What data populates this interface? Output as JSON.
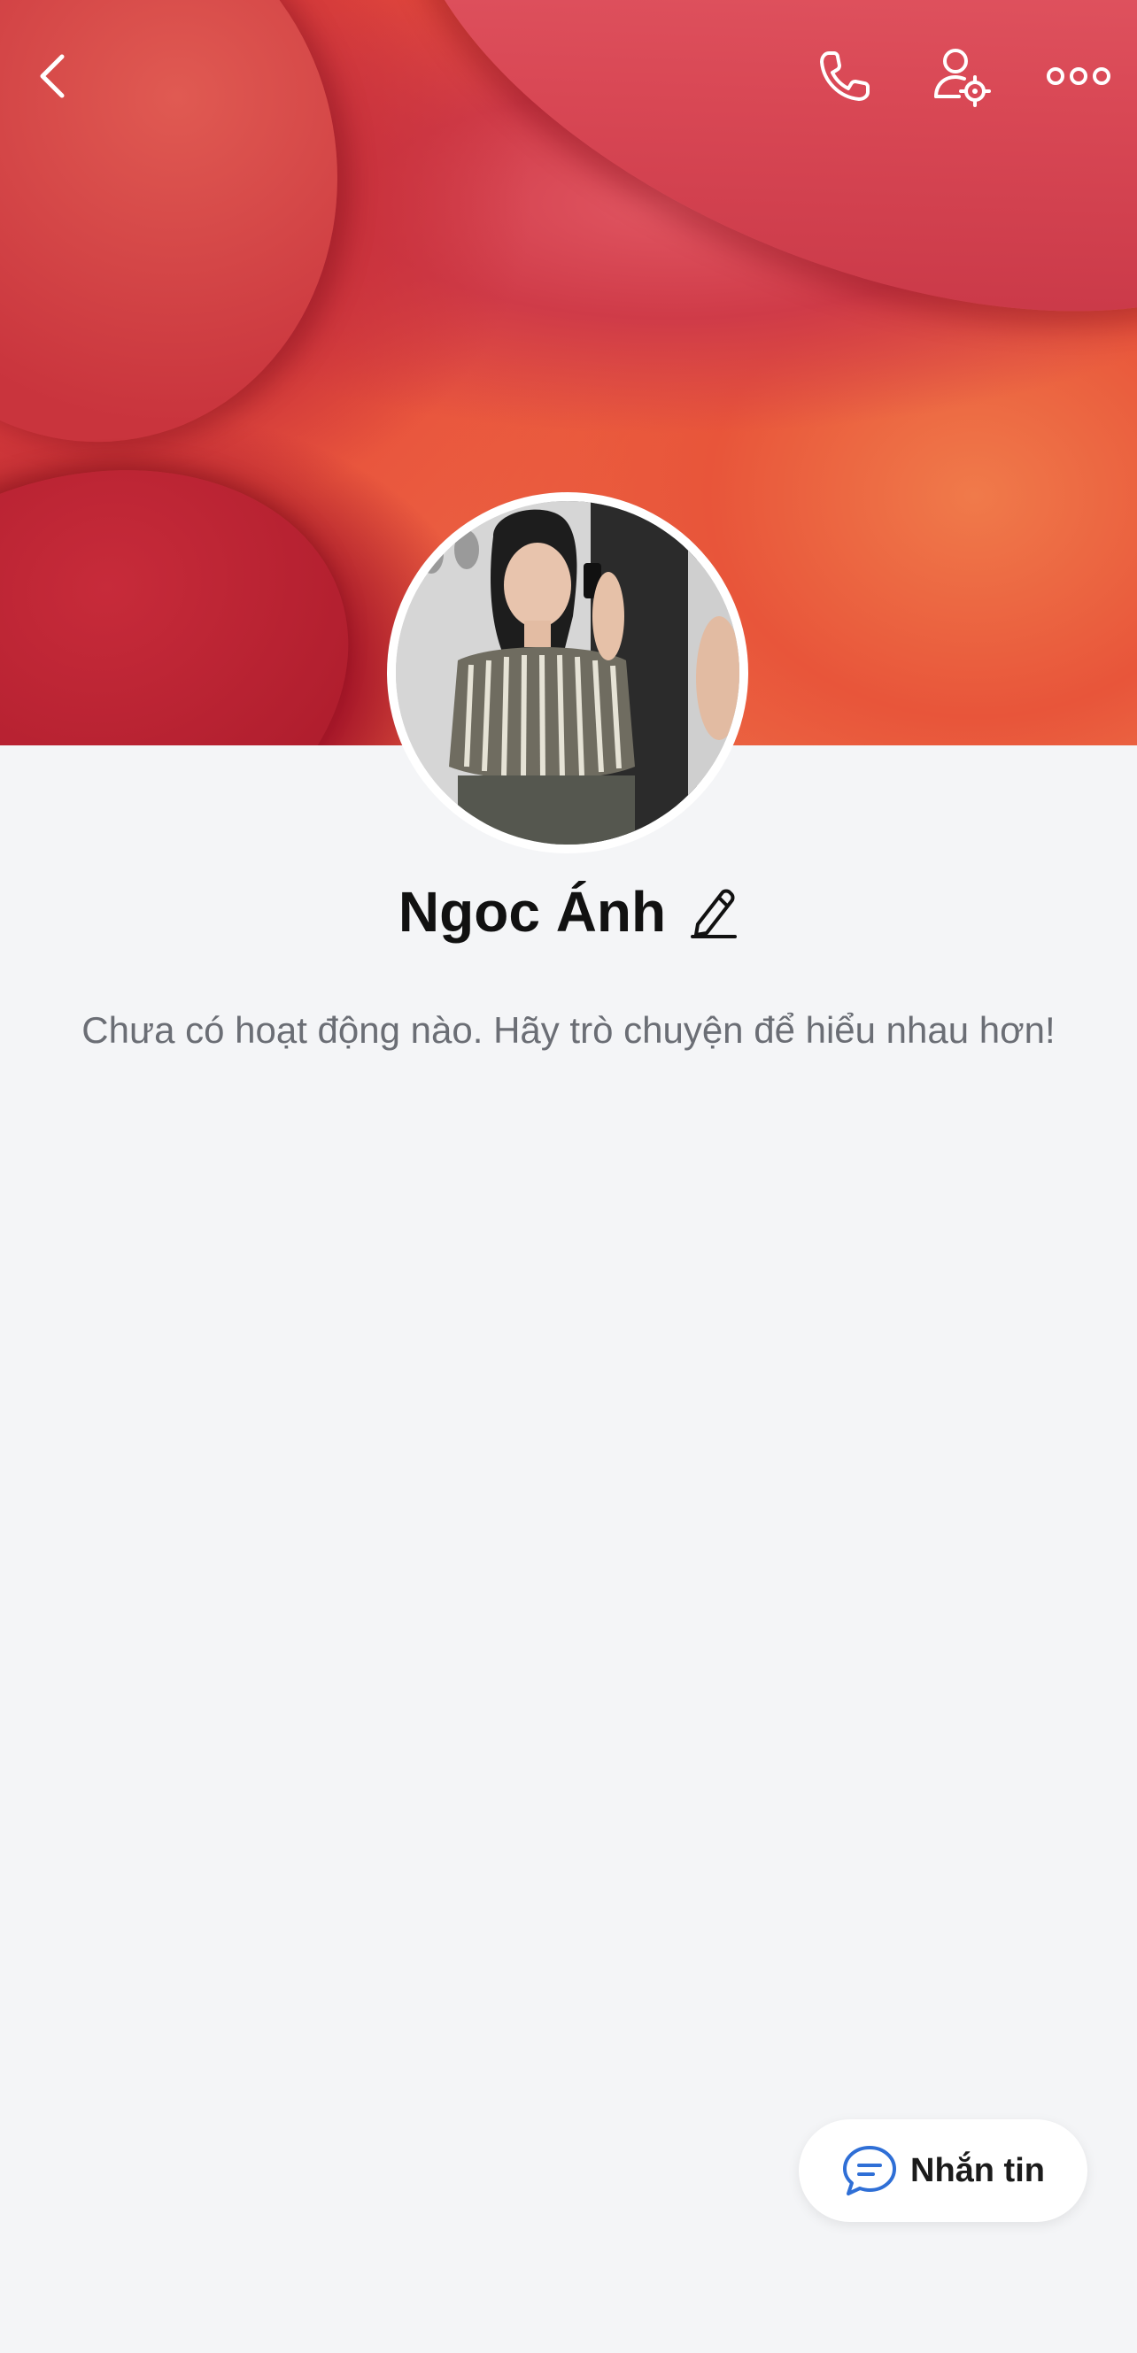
{
  "profile": {
    "name": "Ngoc Ánh",
    "status_text": "Chưa có hoạt động nào. Hãy trò chuyện để hiểu nhau hơn!"
  },
  "actions": {
    "message_label": "Nhắn tin"
  },
  "icons": {
    "back": "chevron-left-icon",
    "call": "phone-icon",
    "settings": "user-settings-icon",
    "more": "more-dots-icon",
    "edit": "pencil-icon",
    "message": "chat-bubble-icon"
  },
  "colors": {
    "background": "#f4f5f7",
    "accent": "#2f6fd6"
  }
}
